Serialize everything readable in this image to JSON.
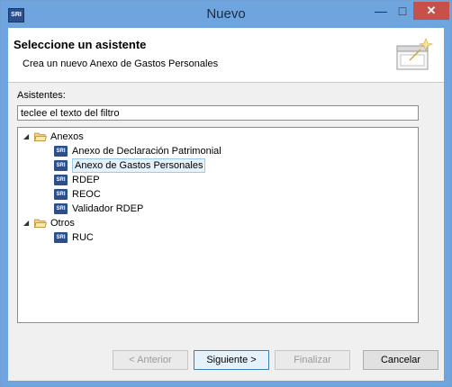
{
  "window": {
    "title": "Nuevo",
    "app_icon_text": "SRI"
  },
  "header": {
    "title": "Seleccione un asistente",
    "description": "Crea un nuevo Anexo de Gastos Personales"
  },
  "asistentes_label": "Asistentes:",
  "filter": {
    "value": "teclee el texto del filtro"
  },
  "tree": {
    "group1": {
      "label": "Anexos",
      "items": [
        "Anexo de Declaración Patrimonial",
        "Anexo de Gastos Personales",
        "RDEP",
        "REOC",
        "Validador RDEP"
      ]
    },
    "group2": {
      "label": "Otros",
      "items": [
        "RUC"
      ]
    },
    "selected_item": "Anexo de Gastos Personales"
  },
  "buttons": {
    "back": "< Anterior",
    "next": "Siguiente >",
    "finish": "Finalizar",
    "cancel": "Cancelar"
  },
  "icons": {
    "sri_badge": "SRI"
  },
  "colors": {
    "titlebar": "#6fa5de",
    "close": "#c7504b",
    "selection": "#e5f1fb"
  }
}
